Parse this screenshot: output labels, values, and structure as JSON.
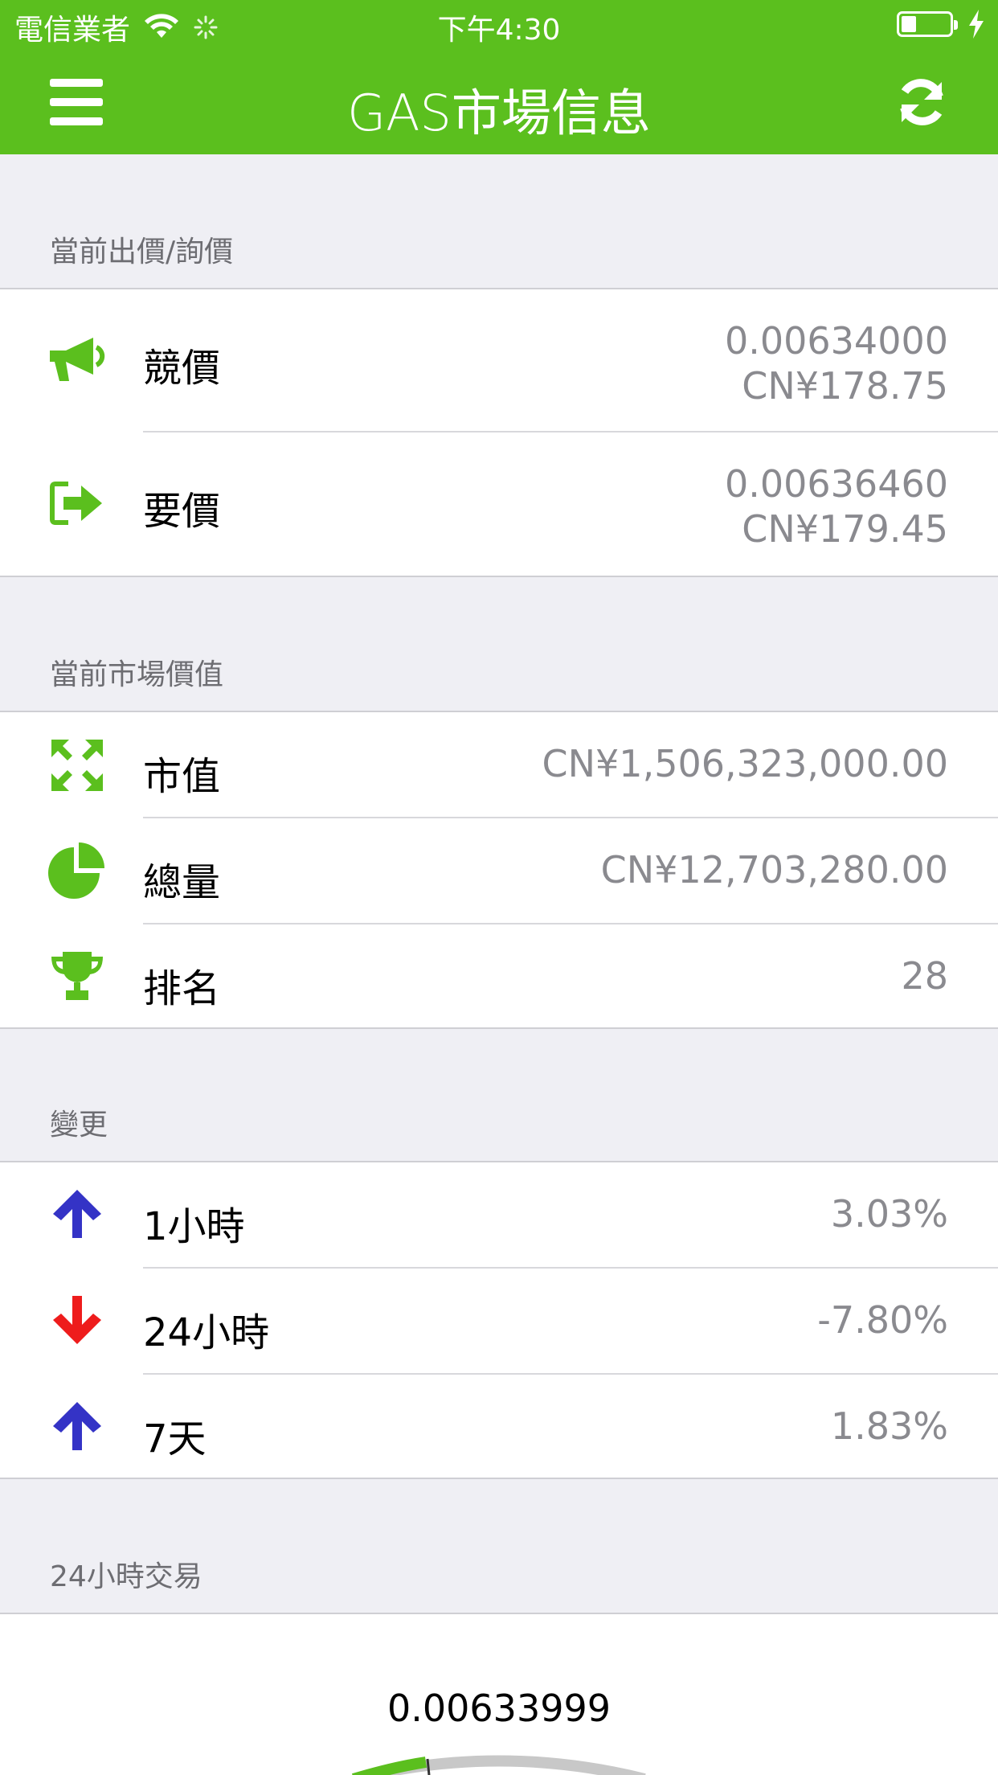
{
  "status_bar": {
    "carrier": "電信業者",
    "time": "下午4:30"
  },
  "nav": {
    "title": "GAS市場信息"
  },
  "sections": {
    "bid_ask": {
      "header": "當前出價/詢價",
      "bid": {
        "label": "競價",
        "value_gas": "0.00634000",
        "value_cny": "CN¥178.75",
        "icon": "megaphone-icon"
      },
      "ask": {
        "label": "要價",
        "value_gas": "0.00636460",
        "value_cny": "CN¥179.45",
        "icon": "sign-out-icon"
      }
    },
    "market": {
      "header": "當前市場價值",
      "market_cap": {
        "label": "市值",
        "value": "CN¥1,506,323,000.00",
        "icon": "expand-icon"
      },
      "supply": {
        "label": "總量",
        "value": "CN¥12,703,280.00",
        "icon": "pie-chart-icon"
      },
      "rank": {
        "label": "排名",
        "value": "28",
        "icon": "trophy-icon"
      }
    },
    "change": {
      "header": "變更",
      "h1": {
        "label": "1小時",
        "value": "3.03%",
        "icon": "arrow-up-icon"
      },
      "h24": {
        "label": "24小時",
        "value": "-7.80%",
        "icon": "arrow-down-icon"
      },
      "d7": {
        "label": "7天",
        "value": "1.83%",
        "icon": "arrow-up-icon"
      }
    },
    "trade": {
      "header": "24小時交易",
      "value": "0.00633999"
    }
  },
  "colors": {
    "brand_green": "#5bbf1e",
    "up_blue": "#3433c6",
    "down_red": "#ee1c1c"
  }
}
